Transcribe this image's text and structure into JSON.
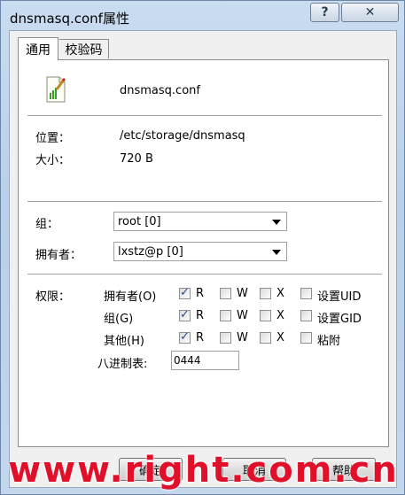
{
  "window": {
    "title": "dnsmasq.conf属性",
    "help_label": "?",
    "close_label": "✕"
  },
  "tabs": [
    {
      "label": "通用"
    },
    {
      "label": "校验码"
    }
  ],
  "file": {
    "icon": "text-file-icon",
    "name": "dnsmasq.conf"
  },
  "info": {
    "location_label": "位置：",
    "location_value": "/etc/storage/dnsmasq",
    "size_label": "大小：",
    "size_value": "720 B"
  },
  "ownership": {
    "group_label": "组：",
    "group_value": "root [0]",
    "owner_label": "拥有者：",
    "owner_value": "lxstz@p [0]"
  },
  "permissions": {
    "label": "权限：",
    "rows": [
      {
        "label": "拥有者(O)",
        "r": "R",
        "w": "W",
        "x": "X",
        "extra": "设置UID",
        "r_checked": true,
        "w_checked": false,
        "x_checked": false,
        "extra_checked": false
      },
      {
        "label": "组(G)",
        "r": "R",
        "w": "W",
        "x": "X",
        "extra": "设置GID",
        "r_checked": true,
        "w_checked": false,
        "x_checked": false,
        "extra_checked": false
      },
      {
        "label": "其他(H)",
        "r": "R",
        "w": "W",
        "x": "X",
        "extra": "粘附",
        "r_checked": true,
        "w_checked": false,
        "x_checked": false,
        "extra_checked": false
      }
    ],
    "octal_label": "八进制表:",
    "octal_value": "0444"
  },
  "buttons": {
    "ok": "确定",
    "cancel": "取消",
    "help": "帮助"
  },
  "watermark": "www.right.com.cn",
  "colors": {
    "title_bar": "#c4d7ec",
    "watermark": "#e0102a",
    "check": "#2b4a8a"
  }
}
